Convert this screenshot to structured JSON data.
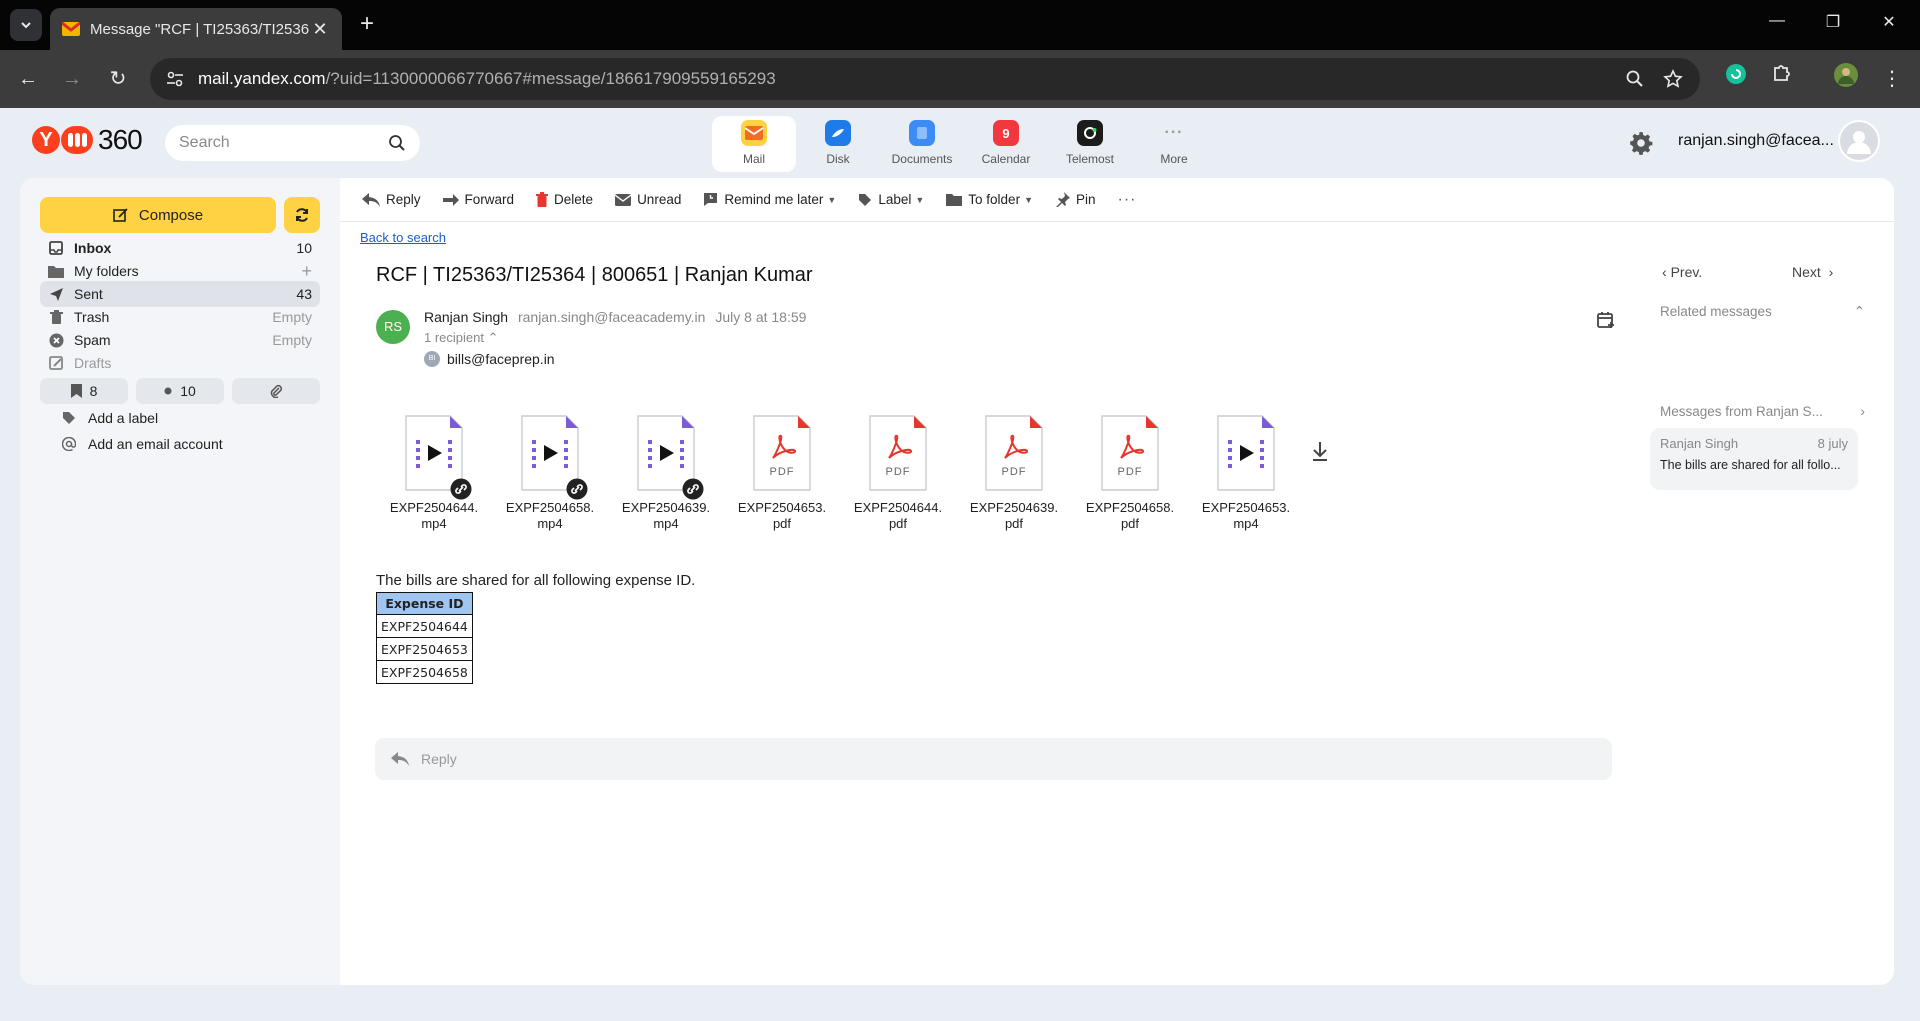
{
  "browser": {
    "tab_title": "Message \"RCF | TI25363/TI2536",
    "url_host": "mail.yandex.com",
    "url_path": "/?uid=1130000066770667#message/186617909559165293"
  },
  "header": {
    "logo_text": "360",
    "search_placeholder": "Search",
    "services": [
      {
        "label": "Mail",
        "icon": "mail-icon",
        "color": "#fed242"
      },
      {
        "label": "Disk",
        "icon": "disk-icon",
        "color": "#1e7be8"
      },
      {
        "label": "Documents",
        "icon": "documents-icon",
        "color": "#3d8bf6"
      },
      {
        "label": "Calendar",
        "icon": "calendar-icon",
        "color": "#f0383e",
        "badge": "9"
      },
      {
        "label": "Telemost",
        "icon": "telemost-icon",
        "color": "#1b1b1b"
      },
      {
        "label": "More",
        "icon": "more-icon",
        "color": "#999999"
      }
    ],
    "account": "ranjan.singh@facea..."
  },
  "sidebar": {
    "compose_label": "Compose",
    "folders": [
      {
        "name": "Inbox",
        "count": "10",
        "icon": "inbox-icon"
      },
      {
        "name": "My folders",
        "count": "+",
        "icon": "folder-icon"
      },
      {
        "name": "Sent",
        "count": "43",
        "icon": "sent-icon"
      },
      {
        "name": "Trash",
        "count": "Empty",
        "icon": "trash-icon"
      },
      {
        "name": "Spam",
        "count": "Empty",
        "icon": "spam-icon"
      },
      {
        "name": "Drafts",
        "count": "",
        "icon": "drafts-icon"
      }
    ],
    "filters": [
      {
        "icon": "bookmark-icon",
        "count": "8"
      },
      {
        "icon": "unread-dot-icon",
        "count": "10"
      },
      {
        "icon": "attachment-icon",
        "count": ""
      }
    ],
    "add_label": "Add a label",
    "add_email_account": "Add an email account"
  },
  "toolbar": {
    "reply": "Reply",
    "forward": "Forward",
    "delete": "Delete",
    "unread": "Unread",
    "remind": "Remind me later",
    "label": "Label",
    "to_folder": "To folder",
    "pin": "Pin"
  },
  "message": {
    "back_to_search": "Back to search",
    "subject": "RCF | TI25363/TI25364 | 800651 | Ranjan Kumar",
    "sender_initials": "RS",
    "sender_name": "Ranjan Singh",
    "sender_email": "ranjan.singh@faceacademy.in",
    "date": "July 8 at 18:59",
    "recipient_count": "1 recipient",
    "recipient_initials": "BI",
    "recipient": "bills@faceprep.in",
    "attachments": [
      {
        "line1": "EXPF2504644.",
        "line2": "mp4",
        "type": "video",
        "link": true
      },
      {
        "line1": "EXPF2504658.",
        "line2": "mp4",
        "type": "video",
        "link": true
      },
      {
        "line1": "EXPF2504639.",
        "line2": "mp4",
        "type": "video",
        "link": true
      },
      {
        "line1": "EXPF2504653.",
        "line2": "pdf",
        "type": "pdf",
        "link": false
      },
      {
        "line1": "EXPF2504644.",
        "line2": "pdf",
        "type": "pdf",
        "link": false
      },
      {
        "line1": "EXPF2504639.",
        "line2": "pdf",
        "type": "pdf",
        "link": false
      },
      {
        "line1": "EXPF2504658.",
        "line2": "pdf",
        "type": "pdf",
        "link": false
      },
      {
        "line1": "EXPF2504653.",
        "line2": "mp4",
        "type": "video",
        "link": false
      }
    ],
    "pdf_label": "PDF",
    "body": "The bills are shared for all following expense ID.",
    "table_header": "Expense ID",
    "table_rows": [
      "EXPF2504644",
      "EXPF2504653",
      "EXPF2504658"
    ],
    "reply_placeholder": "Reply"
  },
  "right_panel": {
    "prev": "Prev.",
    "next": "Next",
    "related_title": "Related messages",
    "related_sender": "Ranjan Singh",
    "related_date": "8 july",
    "related_snippet": "The bills are shared for all follo...",
    "messages_from": "Messages from Ranjan S..."
  }
}
